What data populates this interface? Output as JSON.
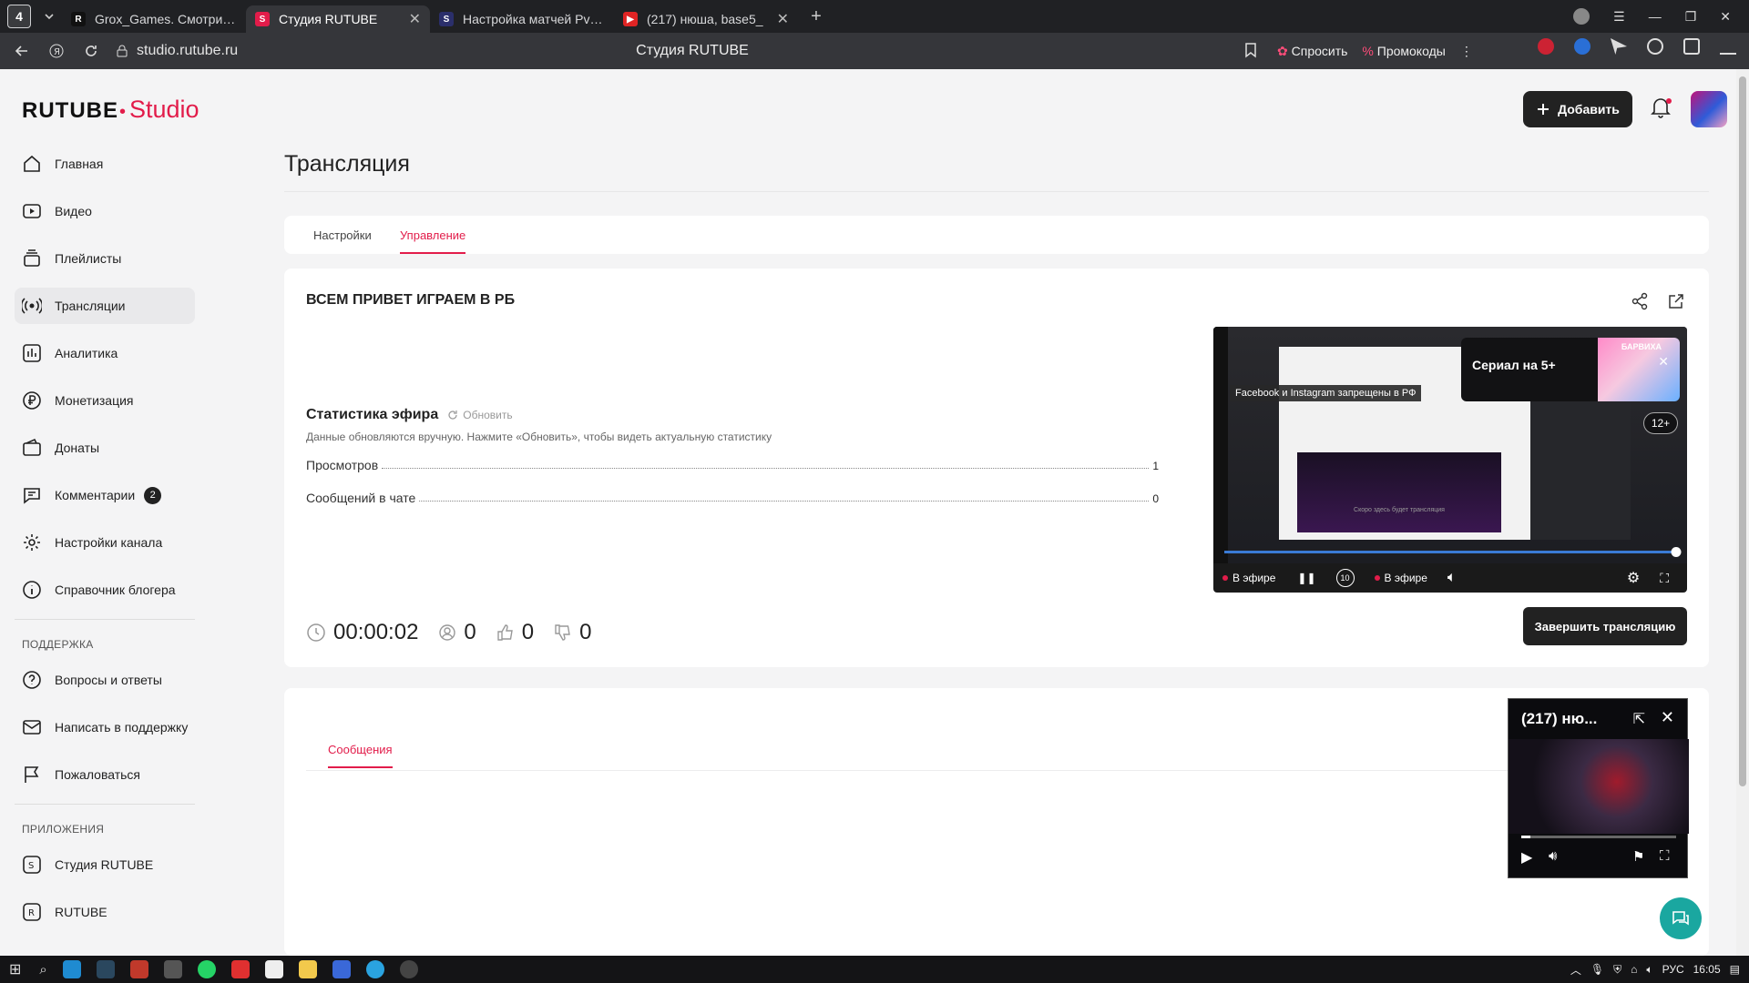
{
  "browser": {
    "tab_count": "4",
    "tabs": [
      {
        "title": "Grox_Games. Смотрите в",
        "favicon": "R",
        "color": "#111111"
      },
      {
        "title": "Студия RUTUBE",
        "favicon": "S",
        "color": "#e21c4a"
      },
      {
        "title": "Настройка матчей PvP в",
        "favicon": "S",
        "color": "#2b2f6b"
      },
      {
        "title": "(217) нюша, base5_",
        "favicon": "▶",
        "color": "#e02424"
      }
    ],
    "url": "studio.rutube.ru",
    "page_title": "Студия RUTUBE",
    "ask_label": "Спросить",
    "promo_label": "Промокоды"
  },
  "app": {
    "logo_main": "RUTUBE",
    "logo_sub": "Studio",
    "add_button": "Добавить"
  },
  "sidebar": {
    "items": [
      {
        "label": "Главная",
        "icon": "home-icon"
      },
      {
        "label": "Видео",
        "icon": "video-icon"
      },
      {
        "label": "Плейлисты",
        "icon": "playlist-icon"
      },
      {
        "label": "Трансляции",
        "icon": "broadcast-icon"
      },
      {
        "label": "Аналитика",
        "icon": "analytics-icon"
      },
      {
        "label": "Монетизация",
        "icon": "ruble-icon"
      },
      {
        "label": "Донаты",
        "icon": "wallet-icon"
      },
      {
        "label": "Комментарии",
        "icon": "comment-icon",
        "badge": "2"
      },
      {
        "label": "Настройки канала",
        "icon": "gear-icon"
      },
      {
        "label": "Справочник блогера",
        "icon": "info-icon"
      }
    ],
    "support_heading": "ПОДДЕРЖКА",
    "support_items": [
      {
        "label": "Вопросы и ответы",
        "icon": "question-icon"
      },
      {
        "label": "Написать в поддержку",
        "icon": "mail-icon"
      },
      {
        "label": "Пожаловаться",
        "icon": "flag-icon"
      }
    ],
    "apps_heading": "ПРИЛОЖЕНИЯ",
    "apps_items": [
      {
        "label": "Студия RUTUBE",
        "icon": "studio-app-icon"
      },
      {
        "label": "RUTUBE",
        "icon": "rutube-app-icon"
      }
    ]
  },
  "main": {
    "title": "Трансляция",
    "tabs": [
      "Настройки",
      "Управление"
    ],
    "stream_title": "ВСЕМ ПРИВЕТ ИГРАЕМ В РБ",
    "stats_title": "Статистика эфира",
    "refresh_label": "Обновить",
    "stats_note": "Данные обновляются вручную. Нажмите «Обновить», чтобы видеть актуальную статистику",
    "stats": [
      {
        "label": "Просмотров",
        "value": "1"
      },
      {
        "label": "Сообщений в чате",
        "value": "0"
      }
    ],
    "duration": "00:00:02",
    "viewers": "0",
    "likes": "0",
    "dislikes": "0",
    "end_button": "Завершить трансляцию",
    "messages_tab": "Сообщения"
  },
  "player": {
    "banner_title": "Сериал на 5+",
    "banner_brand": "БАРВИХА",
    "fb_note": "Facebook и Instagram запрещены в РФ",
    "inner_text": "Скоро здесь будет трансляция",
    "age": "12+",
    "live_label": "В эфире",
    "live_label_2": "В эфире",
    "rewind": "10",
    "progress": 1.0
  },
  "mini_player": {
    "title": "(217) ню...",
    "progress": 0.06
  },
  "taskbar": {
    "lang": "РУС",
    "time": "16:05"
  },
  "colors": {
    "accent": "#e21c4a",
    "dark_button": "#222222"
  }
}
